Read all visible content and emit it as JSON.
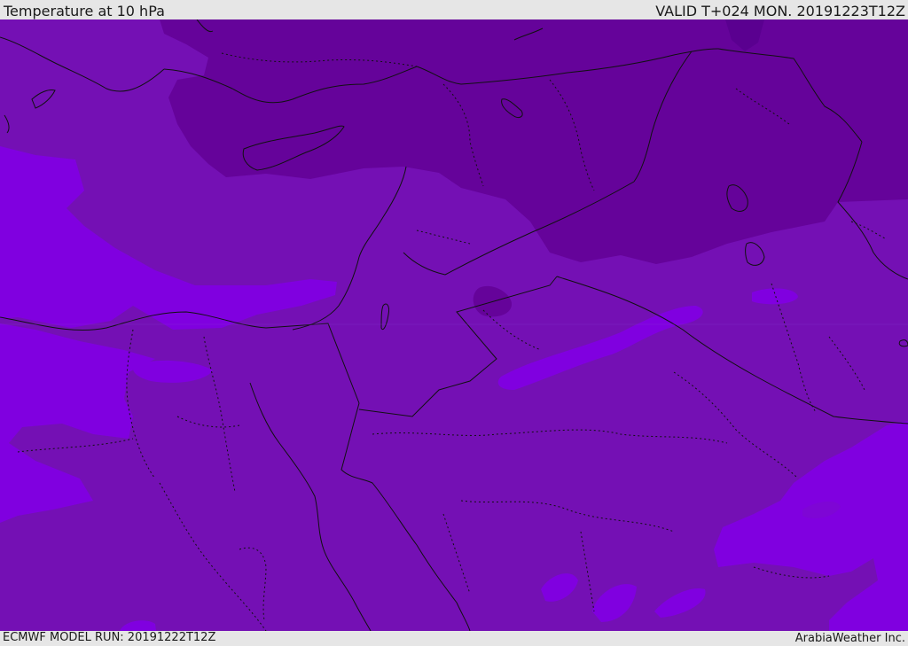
{
  "header": {
    "title": "Temperature at 10 hPa",
    "valid": "VALID T+024 MON. 20191223T12Z"
  },
  "footer": {
    "model_run": "ECMWF MODEL RUN: 20191222T12Z",
    "credit": "ArabiaWeather Inc."
  },
  "colors": {
    "base": "#7410b4",
    "cold": "#65039a",
    "colder": "#5a0090",
    "warm": "#8000e0",
    "borders": "#111111",
    "frame": "#e6e6e6"
  }
}
